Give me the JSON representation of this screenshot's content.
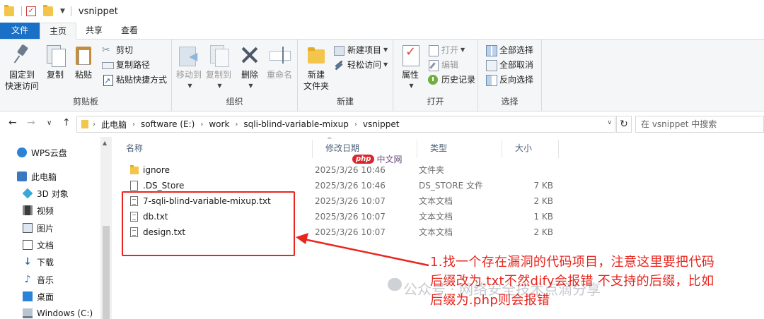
{
  "window": {
    "title": "vsnippet"
  },
  "tabs": [
    {
      "label": "文件"
    },
    {
      "label": "主页"
    },
    {
      "label": "共享"
    },
    {
      "label": "查看"
    }
  ],
  "ribbon": {
    "clipboard": {
      "label": "剪贴板",
      "pin": "固定到\n快速访问",
      "pin_line1": "固定到",
      "pin_line2": "快速访问",
      "copy": "复制",
      "paste": "粘贴",
      "cut": "剪切",
      "copy_path": "复制路径",
      "paste_shortcut": "粘贴快捷方式"
    },
    "organize": {
      "label": "组织",
      "move_to": "移动到",
      "copy_to": "复制到",
      "delete": "删除",
      "rename": "重命名"
    },
    "new": {
      "label": "新建",
      "new_item": "新建项目",
      "easy_access": "轻松访问",
      "new_folder_line1": "新建",
      "new_folder_line2": "文件夹"
    },
    "open": {
      "label": "打开",
      "properties": "属性",
      "open": "打开",
      "edit": "编辑",
      "history": "历史记录"
    },
    "select": {
      "label": "选择",
      "select_all": "全部选择",
      "select_none": "全部取消",
      "invert": "反向选择"
    }
  },
  "address": {
    "crumbs": [
      "此电脑",
      "software (E:)",
      "work",
      "sqli-blind-variable-mixup",
      "vsnippet"
    ],
    "search_placeholder": "在 vsnippet 中搜索"
  },
  "nav": [
    {
      "label": "WPS云盘",
      "icon": "cloud-icon"
    },
    {
      "label": "此电脑",
      "icon": "computer-icon"
    },
    {
      "label": "3D 对象",
      "icon": "cube-icon"
    },
    {
      "label": "视频",
      "icon": "video-icon"
    },
    {
      "label": "图片",
      "icon": "picture-icon"
    },
    {
      "label": "文档",
      "icon": "document-icon"
    },
    {
      "label": "下载",
      "icon": "download-icon"
    },
    {
      "label": "音乐",
      "icon": "music-icon"
    },
    {
      "label": "桌面",
      "icon": "desktop-icon"
    },
    {
      "label": "Windows (C:)",
      "icon": "drive-icon"
    }
  ],
  "columns": {
    "name": "名称",
    "date": "修改日期",
    "type": "类型",
    "size": "大小"
  },
  "files": [
    {
      "name": "ignore",
      "date": "2025/3/26 10:46",
      "type": "文件夹",
      "size": "",
      "icon": "folder-icon"
    },
    {
      "name": ".DS_Store",
      "date": "2025/3/26 10:46",
      "type": "DS_STORE 文件",
      "size": "7 KB",
      "icon": "file-icon"
    },
    {
      "name": "7-sqli-blind-variable-mixup.txt",
      "date": "2025/3/26 10:07",
      "type": "文本文档",
      "size": "2 KB",
      "icon": "text-file-icon"
    },
    {
      "name": "db.txt",
      "date": "2025/3/26 10:07",
      "type": "文本文档",
      "size": "1 KB",
      "icon": "text-file-icon"
    },
    {
      "name": "design.txt",
      "date": "2025/3/26 10:07",
      "type": "文本文档",
      "size": "2 KB",
      "icon": "text-file-icon"
    }
  ],
  "annotation": {
    "line1": "1.找一个存在漏洞的代码项目，注意这里要把代码",
    "line2": "后缀改为.txt不然dify会报错 不支持的后缀，比如",
    "line3": "后缀为.php则会报错",
    "color": "#e8261e"
  },
  "watermarks": {
    "php_badge": "php",
    "php_text": "中文网",
    "gzh": "公众号 · 网络安全技术点滴分享"
  },
  "colors": {
    "accent": "#1a6fc7",
    "annotation_red": "#e8261e",
    "folder": "#f3c54a"
  }
}
